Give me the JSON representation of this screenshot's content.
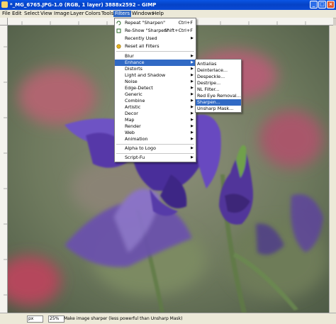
{
  "window": {
    "title": "*_MG_6765.JPG-1.0 (RGB, 1 layer) 3888x2592 – GIMP",
    "minimize": "_",
    "maximize": "□",
    "close": "×"
  },
  "menubar": [
    "File",
    "Edit",
    "Select",
    "View",
    "Image",
    "Layer",
    "Colors",
    "Tools",
    "Filters",
    "Windows",
    "Help"
  ],
  "filters_menu": {
    "repeat": {
      "label": "Repeat \"Sharpen\"",
      "shortcut": "Ctrl+F"
    },
    "reshow": {
      "label": "Re-Show \"Sharpen\"",
      "shortcut": "Shift+Ctrl+F"
    },
    "recently_used": "Recently Used",
    "reset_all": "Reset all Filters",
    "items": [
      "Blur",
      "Enhance",
      "Distorts",
      "Light and Shadow",
      "Noise",
      "Edge-Detect",
      "Generic",
      "Combine",
      "Artistic",
      "Decor",
      "Map",
      "Render",
      "Web",
      "Animation"
    ],
    "alpha_to_logo": "Alpha to Logo",
    "script_fu": "Script-Fu"
  },
  "enhance_submenu": [
    "Antialias",
    "Deinterlace...",
    "Despeckle...",
    "Destripe...",
    "NL Filter...",
    "Red Eye Removal...",
    "Sharpen...",
    "Unsharp Mask..."
  ],
  "statusbar": {
    "unit": "px",
    "zoom": "25%",
    "message": "Make image sharper (less powerful than Unsharp Mask)"
  },
  "colors": {
    "titlebar": "#0a4ad6",
    "highlight": "#316ac5",
    "flower": "#5b3fb8"
  }
}
